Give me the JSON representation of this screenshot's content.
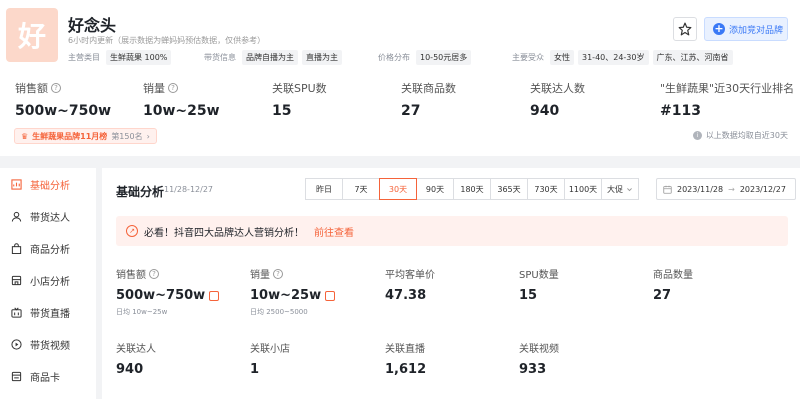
{
  "brand": {
    "logo_char": "好",
    "name": "好念头",
    "update_note": "6小时内更新（展示数据为蝉妈妈预估数据，仅供参考）",
    "main_category_label": "主营类目",
    "main_category": "生鲜蔬果 100%",
    "delivery_label": "带货信息",
    "delivery_tags": [
      "品牌自播为主",
      "直播为主"
    ],
    "price_label": "价格分布",
    "price_tag": "10-50元居多",
    "audience_label": "主要受众",
    "audience_tags": [
      "女性",
      "31-40、24-30岁",
      "广东、江苏、河南省"
    ],
    "add_compete_label": "添加竞对品牌"
  },
  "overview": [
    {
      "label": "销售额",
      "value": "500w~750w",
      "help": true
    },
    {
      "label": "销量",
      "value": "10w~25w",
      "help": true
    },
    {
      "label": "关联SPU数",
      "value": "15"
    },
    {
      "label": "关联商品数",
      "value": "27"
    },
    {
      "label": "关联达人数",
      "value": "940"
    },
    {
      "label": "\"生鲜蔬果\"近30天行业排名",
      "value": "#113"
    }
  ],
  "rank_badge": {
    "title": "生鲜蔬果品牌11月榜",
    "rank": "第150名",
    "arrow": "›"
  },
  "data_note": "以上数据均取自近30天",
  "sidebar": [
    {
      "label": "基础分析",
      "icon": "chart-icon",
      "active": true
    },
    {
      "label": "带货达人",
      "icon": "person-icon"
    },
    {
      "label": "商品分析",
      "icon": "bag-icon"
    },
    {
      "label": "小店分析",
      "icon": "store-icon"
    },
    {
      "label": "带货直播",
      "icon": "live-tv-icon"
    },
    {
      "label": "带货视频",
      "icon": "play-icon"
    },
    {
      "label": "商品卡",
      "icon": "card-icon"
    }
  ],
  "basic": {
    "title": "基础分析",
    "date": "11/28-12/27",
    "tabs": [
      "昨日",
      "7天",
      "30天",
      "90天",
      "180天",
      "365天",
      "730天",
      "1100天",
      "大促"
    ],
    "active_tab": "30天",
    "date_from": "2023/11/28",
    "date_sep": "→",
    "date_to": "2023/12/27"
  },
  "alert": {
    "text": "必看！抖音四大品牌达人营销分析！",
    "link": "前往查看"
  },
  "metrics": [
    {
      "label": "销售额",
      "value": "500w~750w",
      "sub": "日均  10w~25w",
      "help": true,
      "trend": true
    },
    {
      "label": "销量",
      "value": "10w~25w",
      "sub": "日均  2500~5000",
      "help": true,
      "trend": true
    },
    {
      "label": "平均客单价",
      "value": "47.38"
    },
    {
      "label": "SPU数量",
      "value": "15"
    },
    {
      "label": "商品数量",
      "value": "27"
    },
    {
      "label": "关联达人",
      "value": "940"
    },
    {
      "label": "关联小店",
      "value": "1"
    },
    {
      "label": "关联直播",
      "value": "1,612"
    },
    {
      "label": "关联视频",
      "value": "933"
    }
  ],
  "colors": {
    "accent": "#f5633a",
    "blue": "#3a79f6",
    "logo_bg": "#fcd8ca"
  }
}
